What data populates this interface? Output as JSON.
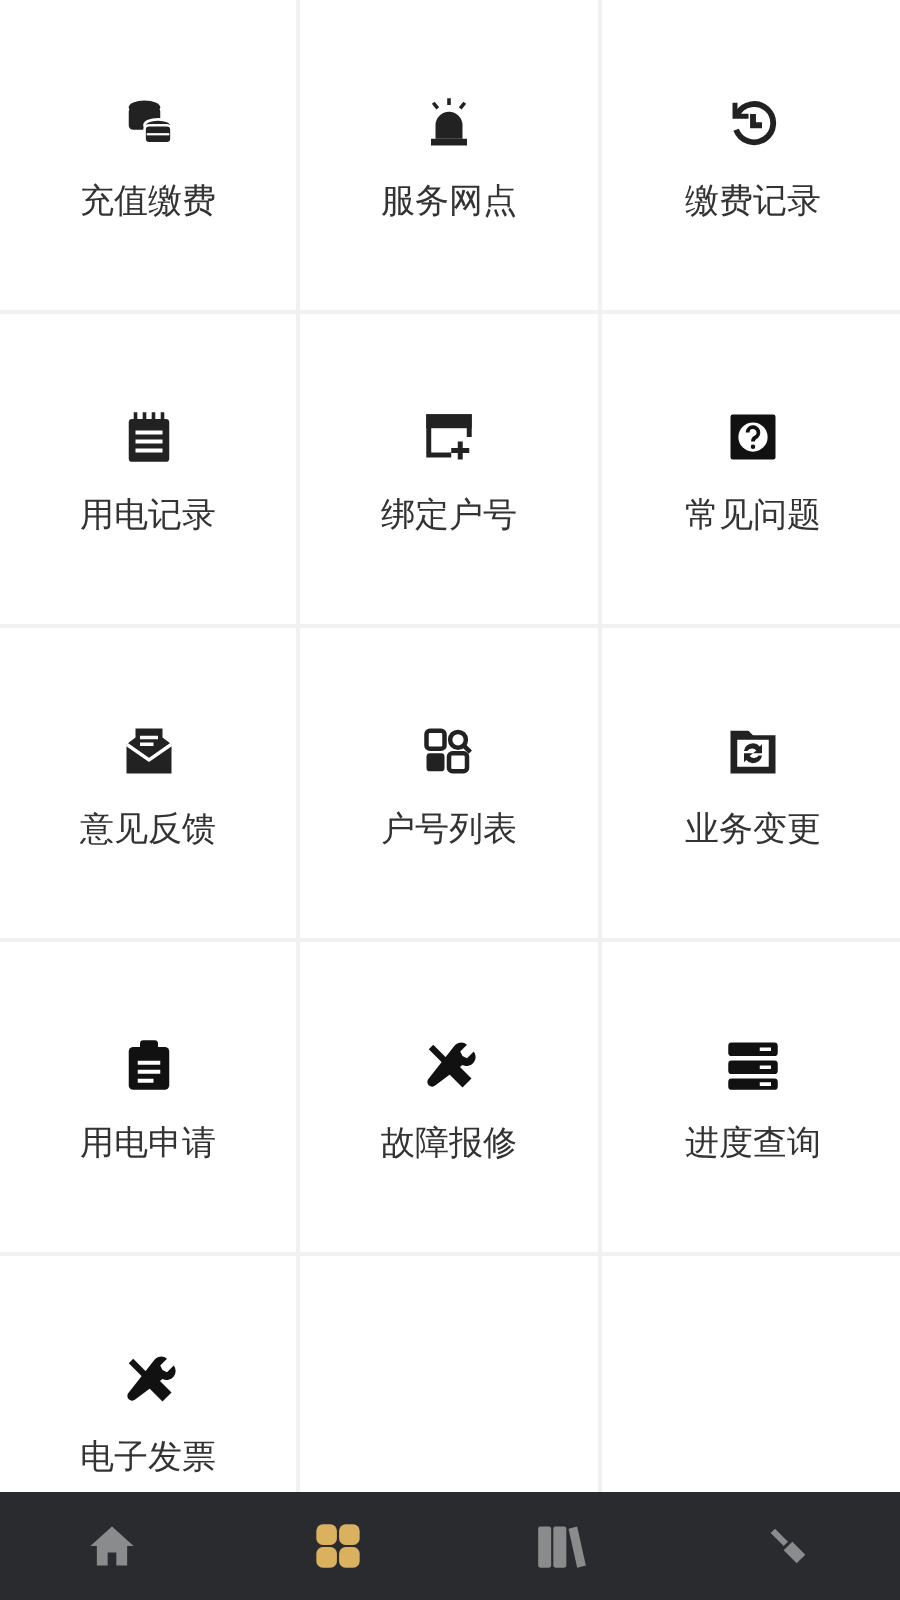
{
  "tiles": [
    {
      "label": "充值缴费"
    },
    {
      "label": "服务网点"
    },
    {
      "label": "缴费记录"
    },
    {
      "label": "用电记录"
    },
    {
      "label": "绑定户号"
    },
    {
      "label": "常见问题"
    },
    {
      "label": "意见反馈"
    },
    {
      "label": "户号列表"
    },
    {
      "label": "业务变更"
    },
    {
      "label": "用电申请"
    },
    {
      "label": "故障报修"
    },
    {
      "label": "进度查询"
    },
    {
      "label": "电子发票"
    }
  ],
  "tabs": [
    {
      "selected": false
    },
    {
      "selected": true
    },
    {
      "selected": false
    },
    {
      "selected": false
    }
  ]
}
